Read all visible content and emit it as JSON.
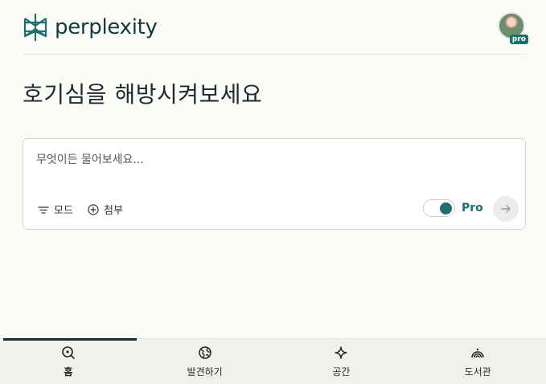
{
  "header": {
    "brand_name": "perplexity",
    "avatar_badge": "pro"
  },
  "main": {
    "title": "호기심을 해방시켜보세요"
  },
  "query": {
    "placeholder": "무엇이든 물어보세요...",
    "mode_label": "모드",
    "attach_label": "첨부",
    "pro_label": "Pro",
    "pro_enabled": true
  },
  "nav": {
    "items": [
      {
        "label": "홈",
        "icon": "search-icon",
        "active": true
      },
      {
        "label": "발견하기",
        "icon": "globe-icon",
        "active": false
      },
      {
        "label": "공간",
        "icon": "sparkle-icon",
        "active": false
      },
      {
        "label": "도서관",
        "icon": "library-icon",
        "active": false
      }
    ]
  },
  "colors": {
    "accent": "#1f6f6e",
    "background": "#fbfbf7"
  }
}
